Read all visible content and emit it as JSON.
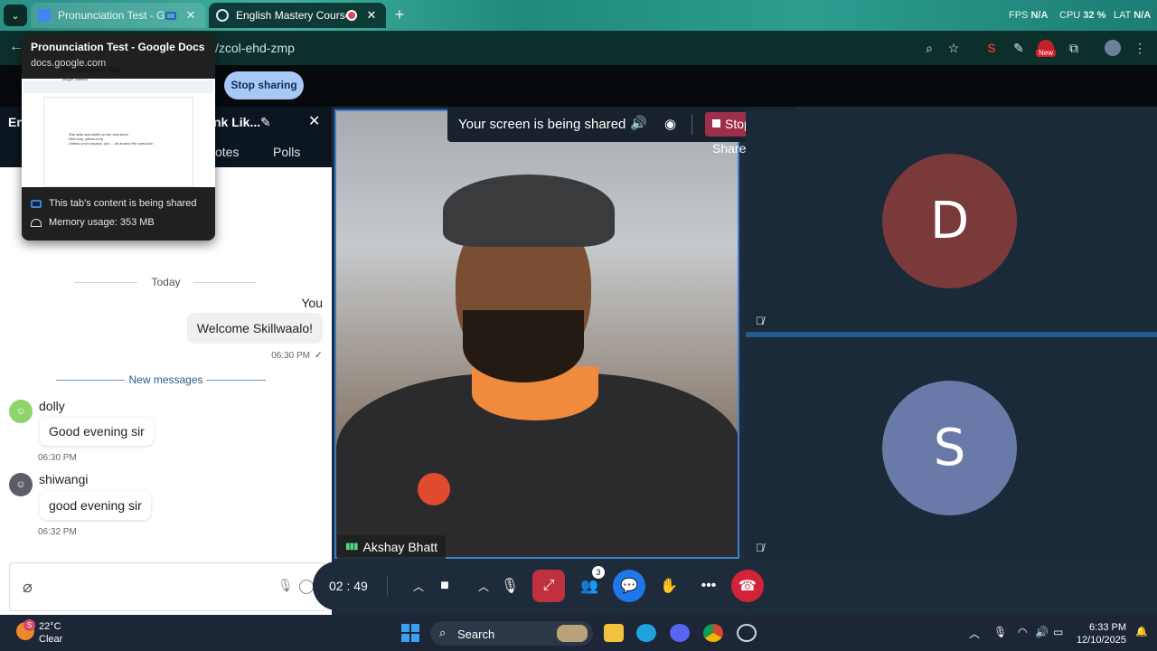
{
  "browser": {
    "tabs": [
      {
        "title": "Pronunciation Test - Google",
        "active": false
      },
      {
        "title": "English Mastery Course (Lea",
        "active": true
      }
    ],
    "perf": {
      "fps_label": "FPS",
      "fps_value": "N/A",
      "cpu_label": "CPU",
      "cpu_value": "32 %",
      "lat_label": "LAT",
      "lat_value": "N/A"
    },
    "url": "/zcol-ehd-zmp",
    "extension_badge": "New"
  },
  "hover_card": {
    "title": "Pronunciation Test - Google Docs",
    "domain": "docs.google.com",
    "preview": {
      "doc_title": "Pronunciation Test",
      "doc_subtitle": "Tongue Twisters",
      "bullets": [
        "She sells sea shells on the sea shore",
        "Red lorry, yellow lorry",
        "Unless you'd unpack, you ... all around the carrot-ton"
      ]
    },
    "sharing_note": "This tab's content is being shared",
    "memory_note": "Memory usage: 353 MB"
  },
  "app": {
    "stop_sharing_label": "Stop sharing"
  },
  "sidebar": {
    "title_left": "En",
    "title": "nk Lik...",
    "tabs": [
      "otes",
      "Polls"
    ],
    "divider_today": "Today",
    "you_label": "You",
    "my_message": {
      "text": "Welcome Skillwaalo!",
      "time": "06:30 PM"
    },
    "new_messages_label": "New messages",
    "messages": [
      {
        "sender": "dolly",
        "text": "Good evening sir",
        "time": "06:30 PM",
        "avatar_color": "#8fd36b"
      },
      {
        "sender": "shiwangi",
        "text": "good evening sir",
        "time": "06:32 PM",
        "avatar_color": "#5a5f66"
      }
    ]
  },
  "meeting": {
    "share_banner": {
      "message": "Your screen is being shared",
      "stop_label": "Stop Share"
    },
    "main_participant": "Akshay Bhatt",
    "tiles": [
      {
        "initial": "D",
        "color": "#7a3a3a"
      },
      {
        "initial": "S",
        "color": "#6a7aa8"
      }
    ],
    "timer": "02 : 49",
    "participants_count": "3"
  },
  "taskbar": {
    "temperature": "22°C",
    "condition": "Clear",
    "weather_badge": "S",
    "search_label": "Search",
    "time": "6:33 PM",
    "date": "12/10/2025"
  }
}
